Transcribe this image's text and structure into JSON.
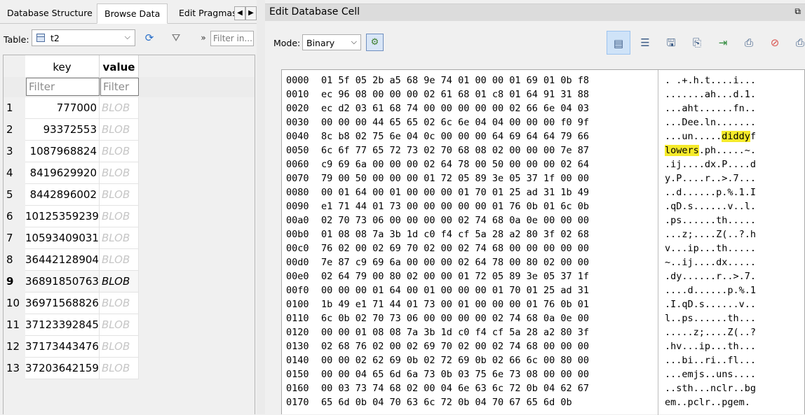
{
  "left": {
    "tabs": [
      "Database Structure",
      "Browse Data",
      "Edit Pragmas"
    ],
    "active_tab": "Browse Data",
    "table_label": "Table:",
    "table_value": "t2",
    "filter_placeholder": "Filter in...",
    "columns": [
      "key",
      "value"
    ],
    "filter_text": "Filter",
    "rows": [
      {
        "n": "1",
        "key": "777000",
        "value": "BLOB"
      },
      {
        "n": "2",
        "key": "93372553",
        "value": "BLOB"
      },
      {
        "n": "3",
        "key": "1087968824",
        "value": "BLOB"
      },
      {
        "n": "4",
        "key": "8419629920",
        "value": "BLOB"
      },
      {
        "n": "5",
        "key": "8442896002",
        "value": "BLOB"
      },
      {
        "n": "6",
        "key": "10125359239",
        "value": "BLOB"
      },
      {
        "n": "7",
        "key": "10593409031",
        "value": "BLOB"
      },
      {
        "n": "8",
        "key": "36442128904",
        "value": "BLOB"
      },
      {
        "n": "9",
        "key": "36891850763",
        "value": "BLOB"
      },
      {
        "n": "10",
        "key": "36971568826",
        "value": "BLOB"
      },
      {
        "n": "11",
        "key": "37123392845",
        "value": "BLOB"
      },
      {
        "n": "12",
        "key": "37173443476",
        "value": "BLOB"
      },
      {
        "n": "13",
        "key": "37203642159",
        "value": "BLOB"
      }
    ],
    "selected_row": "9"
  },
  "right": {
    "title": "Edit Database Cell",
    "mode_label": "Mode:",
    "mode_value": "Binary",
    "hex_lines": [
      {
        "addr": "0000",
        "hex": "01 5f 05 2b a5 68 9e 74 01 00 00 01 69 01 0b f8",
        "ascii": ". .+.h.t....i..."
      },
      {
        "addr": "0010",
        "hex": "ec 96 08 00 00 00 02 61 68 01 c8 01 64 91 31 88",
        "ascii": ".......ah...d.1."
      },
      {
        "addr": "0020",
        "hex": "ec d2 03 61 68 74 00 00 00 00 00 02 66 6e 04 03",
        "ascii": "...aht......fn.."
      },
      {
        "addr": "0030",
        "hex": "00 00 00 44 65 65 02 6c 6e 04 04 00 00 00 f0 9f",
        "ascii": "...Dee.ln......."
      },
      {
        "addr": "0040",
        "hex": "8c b8 02 75 6e 04 0c 00 00 00 64 69 64 64 79 66",
        "ascii": "...un.....diddyf"
      },
      {
        "addr": "0050",
        "hex": "6c 6f 77 65 72 73 02 70 68 08 02 00 00 00 7e 87",
        "ascii": "lowers.ph.....~."
      },
      {
        "addr": "0060",
        "hex": "c9 69 6a 00 00 00 02 64 78 00 50 00 00 00 02 64",
        "ascii": ".ij....dx.P....d"
      },
      {
        "addr": "0070",
        "hex": "79 00 50 00 00 00 01 72 05 89 3e 05 37 1f 00 00",
        "ascii": "y.P....r..>.7..."
      },
      {
        "addr": "0080",
        "hex": "00 01 64 00 01 00 00 00 01 70 01 25 ad 31 1b 49",
        "ascii": "..d......p.%.1.I"
      },
      {
        "addr": "0090",
        "hex": "e1 71 44 01 73 00 00 00 00 00 01 76 0b 01 6c 0b",
        "ascii": ".qD.s......v..l."
      },
      {
        "addr": "00a0",
        "hex": "02 70 73 06 00 00 00 00 02 74 68 0a 0e 00 00 00",
        "ascii": ".ps......th....."
      },
      {
        "addr": "00b0",
        "hex": "01 08 08 7a 3b 1d c0 f4 cf 5a 28 a2 80 3f 02 68",
        "ascii": "...z;....Z(..?.h"
      },
      {
        "addr": "00c0",
        "hex": "76 02 00 02 69 70 02 00 02 74 68 00 00 00 00 00",
        "ascii": "v...ip...th....."
      },
      {
        "addr": "00d0",
        "hex": "7e 87 c9 69 6a 00 00 00 02 64 78 00 80 02 00 00",
        "ascii": "~..ij....dx....."
      },
      {
        "addr": "00e0",
        "hex": "02 64 79 00 80 02 00 00 01 72 05 89 3e 05 37 1f",
        "ascii": ".dy......r..>.7."
      },
      {
        "addr": "00f0",
        "hex": "00 00 00 01 64 00 01 00 00 00 01 70 01 25 ad 31",
        "ascii": "....d......p.%.1"
      },
      {
        "addr": "0100",
        "hex": "1b 49 e1 71 44 01 73 00 01 00 00 00 01 76 0b 01",
        "ascii": ".I.qD.s......v.."
      },
      {
        "addr": "0110",
        "hex": "6c 0b 02 70 73 06 00 00 00 00 02 74 68 0a 0e 00",
        "ascii": "l..ps......th..."
      },
      {
        "addr": "0120",
        "hex": "00 00 01 08 08 7a 3b 1d c0 f4 cf 5a 28 a2 80 3f",
        "ascii": ".....z;....Z(..?"
      },
      {
        "addr": "0130",
        "hex": "02 68 76 02 00 02 69 70 02 00 02 74 68 00 00 00",
        "ascii": ".hv...ip...th..."
      },
      {
        "addr": "0140",
        "hex": "00 00 02 62 69 0b 02 72 69 0b 02 66 6c 00 80 00",
        "ascii": "...bi..ri..fl..."
      },
      {
        "addr": "0150",
        "hex": "00 00 04 65 6d 6a 73 0b 03 75 6e 73 08 00 00 00",
        "ascii": "...emjs..uns...."
      },
      {
        "addr": "0160",
        "hex": "00 03 73 74 68 02 00 04 6e 63 6c 72 0b 04 62 67",
        "ascii": "..sth...nclr..bg"
      },
      {
        "addr": "0170",
        "hex": "65 6d 0b 04 70 63 6c 72 0b 04 70 67 65 6d 0b",
        "ascii": "em..pclr..pgem."
      }
    ]
  }
}
